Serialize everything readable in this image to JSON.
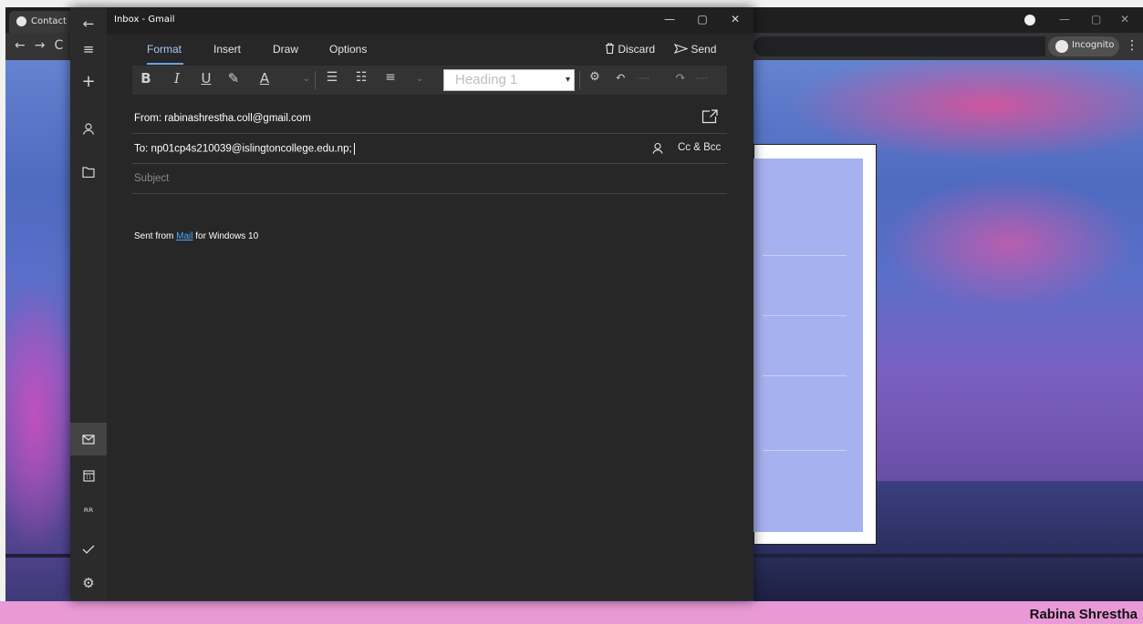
{
  "browser": {
    "tab_title": "Contact",
    "incognito_label": "Incognito",
    "menu_icon": "more-vert-icon"
  },
  "window": {
    "title": "Inbox - Gmail"
  },
  "ribbon": {
    "tabs": [
      "Format",
      "Insert",
      "Draw",
      "Options"
    ],
    "active_tab": "Format",
    "discard_label": "Discard",
    "send_label": "Send"
  },
  "toolbar": {
    "bold": "B",
    "italic": "I",
    "underline": "U",
    "font_color": "A",
    "style_value": "Heading 1"
  },
  "compose": {
    "from_label": "From:",
    "from_value": "rabinashrestha.coll@gmail.com",
    "to_label": "To:",
    "to_value": "np01cp4s210039@islingtoncollege.edu.np;",
    "cc_bcc_label": "Cc & Bcc",
    "subject_placeholder": "Subject",
    "signature_prefix": "Sent from ",
    "signature_link": "Mail",
    "signature_suffix": " for Windows 10"
  },
  "footer": {
    "author": "Rabina Shrestha"
  },
  "colors": {
    "app_bg": "#272727",
    "rail_bg": "#2b2b2b",
    "accent": "#6ea0e0",
    "link": "#4aa8ff",
    "pink_strip": "#e99ad6"
  }
}
